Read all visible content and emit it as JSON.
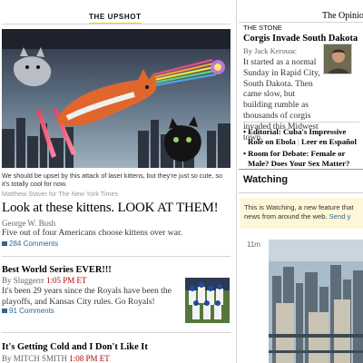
{
  "upshot": {
    "section_label": "THE UPSHOT",
    "caption": "We should be upset by this attack of laser kittens, but they're just so cute, so it's totally cool for now.",
    "credit": "Matthew Staver for The New York Times",
    "headline": "Look at these kittens. LOOK AT THEM!",
    "byline": "George W. Bush",
    "summary": "Five out of four Americans choose kittens over war.",
    "comments": "284 Comments"
  },
  "stories": [
    {
      "headline": "Best World Series EVER!!!",
      "byline_prefix": "By Sluggerrr",
      "time": "1:05 PM ET",
      "summary": "It's been 29 years since the Royals have been the playoffs, and Kansas City rules. Go Royals!",
      "comments": "91 Comments"
    },
    {
      "headline": "It's Getting Cold and I Don't Like It",
      "byline_prefix": "By MITCH SMITH",
      "time": "1:08 PM ET"
    }
  ],
  "opinion": {
    "title": "The Opinio",
    "kicker": "THE STONE",
    "headline": "Corgis Invade South Dakota",
    "byline": "By Jack Kerouac",
    "body": "It started as a normal Sunday in Rapid City, South Dakota. Then came slow, but building rumble as thousands of corgis invaded this Midwest town.",
    "links": [
      {
        "text": "Editorial: Cuba's Impressive Role on Ebola",
        "sep": " | ",
        "extra": "Leer en Español"
      },
      {
        "text": "Room for Debate: Female or Male? Does Your Sex Matter?"
      }
    ]
  },
  "watching": {
    "title": "Watching",
    "note_line1": "This is Watching, a new feature that",
    "note_line2": "news from around the web.",
    "note_more": " Send y",
    "time": "11m"
  },
  "colors": {
    "accent_yellow": "#ffd400",
    "link_blue": "#326891",
    "time_red": "#b20000",
    "note_bg": "#fdf6d8"
  },
  "icons": [
    "comment-bubble-icon"
  ]
}
